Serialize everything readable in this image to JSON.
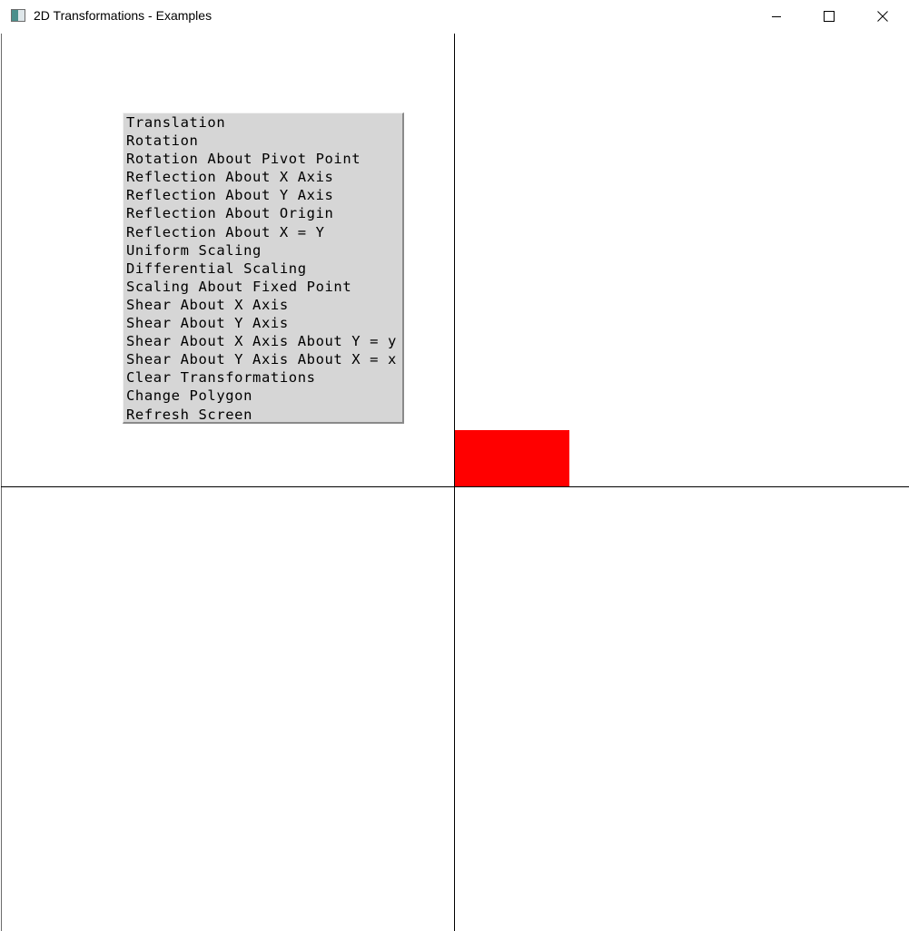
{
  "window": {
    "title": "2D Transformations - Examples"
  },
  "controls": {
    "minimize_icon": "minimize-icon",
    "maximize_icon": "maximize-icon",
    "close_icon": "close-icon"
  },
  "canvas": {
    "polygon_color": "#ff0000",
    "axis_color": "#000000",
    "background": "#ffffff"
  },
  "menu": {
    "background": "#d6d6d6",
    "items": [
      {
        "label": "Translation"
      },
      {
        "label": "Rotation"
      },
      {
        "label": "Rotation About Pivot Point"
      },
      {
        "label": "Reflection About X Axis"
      },
      {
        "label": "Reflection About Y Axis"
      },
      {
        "label": "Reflection About Origin"
      },
      {
        "label": "Reflection About X = Y"
      },
      {
        "label": "Uniform Scaling"
      },
      {
        "label": "Differential Scaling"
      },
      {
        "label": "Scaling About Fixed Point"
      },
      {
        "label": "Shear About X Axis"
      },
      {
        "label": "Shear About Y Axis"
      },
      {
        "label": "Shear About X Axis About Y = y"
      },
      {
        "label": "Shear About Y Axis About X = x"
      },
      {
        "label": "Clear Transformations"
      },
      {
        "label": "Change Polygon"
      },
      {
        "label": "Refresh Screen"
      }
    ]
  }
}
